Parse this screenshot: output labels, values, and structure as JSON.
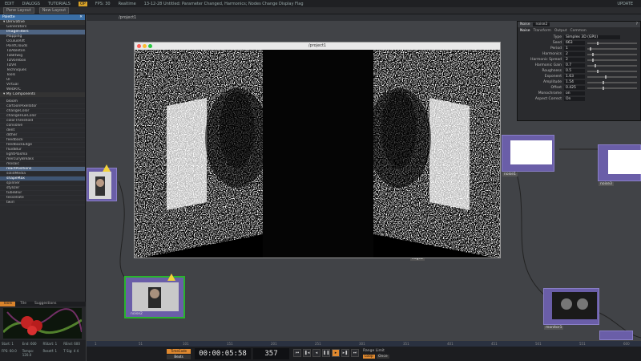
{
  "menubar": {
    "items": [
      "EDIT",
      "DIALOGS",
      "TUTORIALS"
    ],
    "badge": "OP",
    "fps_label": "FPS: 30",
    "realtime": "Realtime",
    "message": "13-12-28 Untitled: Parameter Changed, Harmonics; Nodes Change Display Flag",
    "update": "UPDATE"
  },
  "toolbar": {
    "pane_split": "Pane Layout",
    "new_layout": "New Layout"
  },
  "path": {
    "label": "/project1"
  },
  "palette": {
    "title": "Palette",
    "derivative_header": "Derivative",
    "items": [
      "Generators",
      "ImageFilters",
      "Mapping",
      "OculusRift",
      "PointClouds",
      "TDAbleton",
      "TDBitwig",
      "TDVorebox",
      "TDVR",
      "Techniques",
      "Tools",
      "UI",
      "Virtual",
      "WebRTC"
    ],
    "components_header": "My Components",
    "components": [
      "bloom",
      "cartoonPixellator",
      "changeColor",
      "changeHueColor",
      "colorThreshold",
      "convolve",
      "dent",
      "dither",
      "feedback",
      "feedbackEdge",
      "fluidBlur",
      "lightPlasma",
      "mercuryBreaks",
      "mosaic",
      "reactPositions",
      "solidMedia",
      "shapeMax",
      "spinner",
      "stylizer",
      "tubeBlur",
      "tessellate",
      "twirl"
    ],
    "selected": "ImageFilters"
  },
  "bottom_tabs": [
    "Tools",
    "Tile",
    "Suggestions"
  ],
  "window": {
    "title": "/project1"
  },
  "nodes": {
    "n1_label": "",
    "n2_label": "noise2",
    "n3_label": "noise1",
    "n4_label": "noise3",
    "n5_label": "monitor1",
    "n6_label": "edge2",
    "n7_label": "null1"
  },
  "param": {
    "op_type": "Noise",
    "op_name": "noise2",
    "tabs": [
      "Noise",
      "Transform",
      "Output",
      "Common"
    ],
    "rows": [
      {
        "name": "Type",
        "value": "Simplex 3D (GPU)"
      },
      {
        "name": "Seed",
        "value": "663"
      },
      {
        "name": "Period",
        "value": "1"
      },
      {
        "name": "Harmonics",
        "value": "2"
      },
      {
        "name": "Harmonic Spread",
        "value": "2"
      },
      {
        "name": "Harmonic Gain",
        "value": "0.7"
      },
      {
        "name": "Roughness",
        "value": "0.5"
      },
      {
        "name": "Exponent",
        "value": "1.63"
      },
      {
        "name": "Amplitude",
        "value": "1.54"
      },
      {
        "name": "Offset",
        "value": "0.425"
      },
      {
        "name": "Monochrome",
        "value": "on"
      },
      {
        "name": "Aspect Correct",
        "value": "On"
      }
    ]
  },
  "stats": {
    "cells": [
      "Start: 1",
      "End: 600",
      "RStart: 1",
      "REnd: 600",
      "FPS: 60.0",
      "Tempo: 120.0",
      "Resetf: 1",
      "T Sig: 4 4"
    ]
  },
  "timeline": {
    "timecode": "00:00:05:58",
    "frame": "357",
    "timecode_label": "TimeCode",
    "beats": "Beats",
    "range_label": "Range Limit",
    "loop": "Loop",
    "once": "Once",
    "ruler": [
      "1",
      "51",
      "101",
      "151",
      "201",
      "251",
      "301",
      "351",
      "401",
      "451",
      "501",
      "551",
      "600"
    ]
  },
  "colors": {
    "accent": "#e0892f",
    "node": "#6a5ea8",
    "selected": "#4e6482"
  }
}
